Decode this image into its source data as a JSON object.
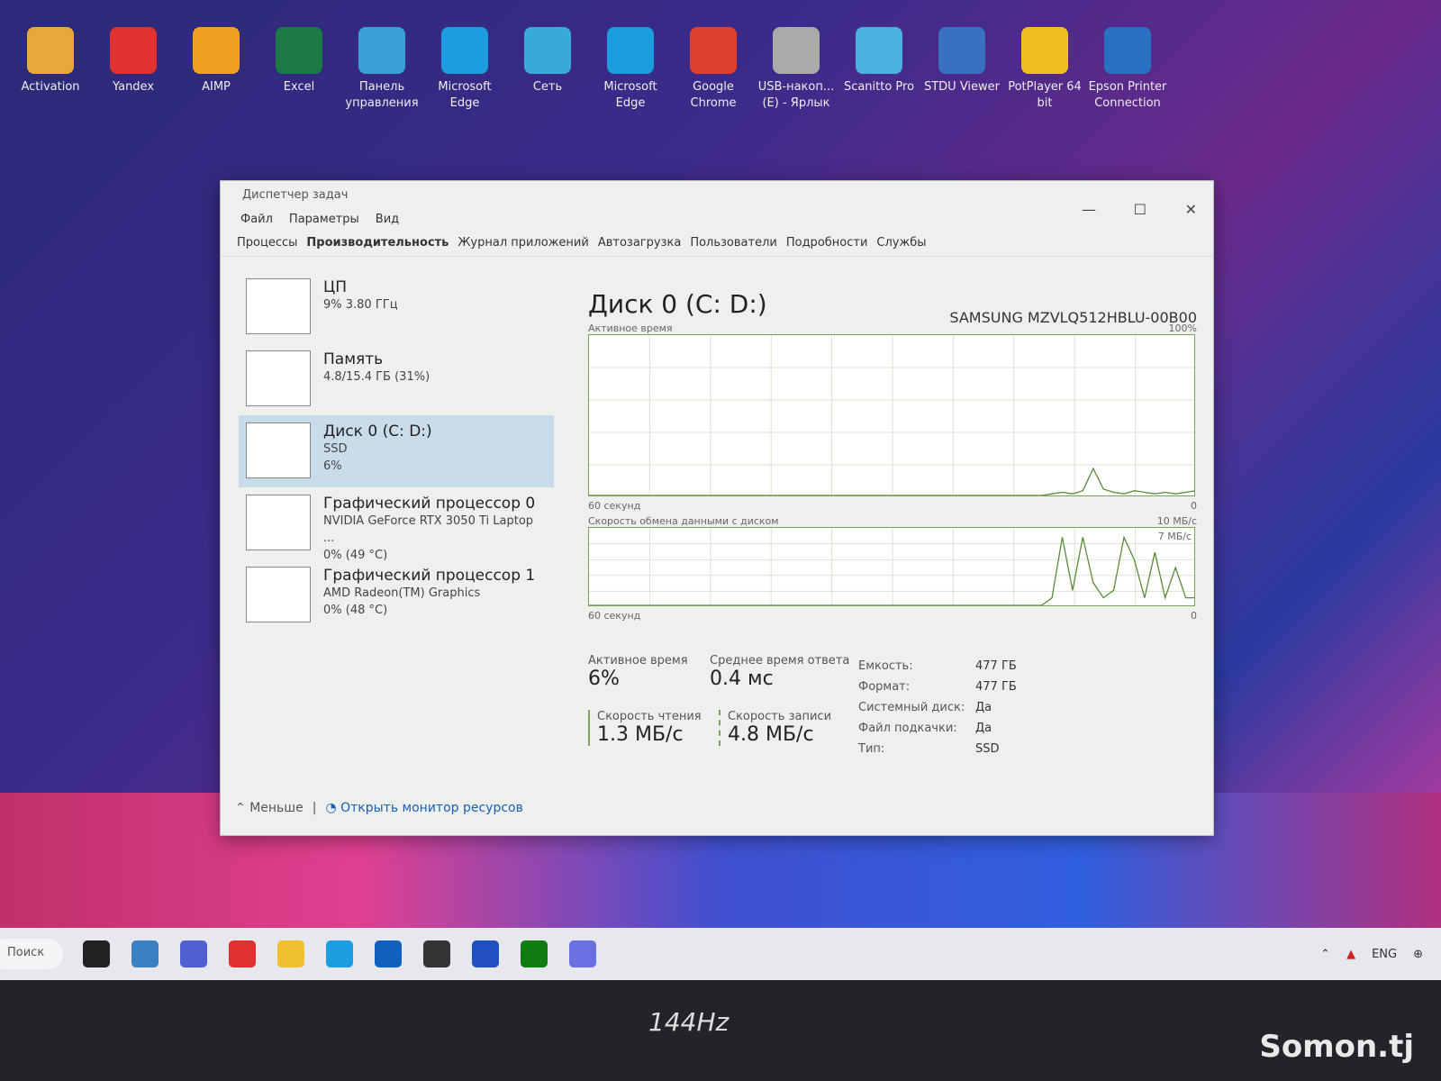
{
  "desktop": {
    "icons": [
      {
        "label": "Activation",
        "color": "#e8a83a"
      },
      {
        "label": "Yandex",
        "color": "#e03030"
      },
      {
        "label": "AIMP",
        "color": "#f0a020"
      },
      {
        "label": "Excel",
        "color": "#1e7a44"
      },
      {
        "label": "Панель управления",
        "color": "#3aa0d8"
      },
      {
        "label": "Microsoft Edge",
        "color": "#1b9de0"
      },
      {
        "label": "Сеть",
        "color": "#3aa8d8"
      },
      {
        "label": "Microsoft Edge",
        "color": "#1b9de0"
      },
      {
        "label": "Google Chrome",
        "color": "#e04030"
      },
      {
        "label": "USB-накоп... (E) - Ярлык",
        "color": "#aaa"
      },
      {
        "label": "Scanitto Pro",
        "color": "#4ab0e0"
      },
      {
        "label": "STDU Viewer",
        "color": "#3a70c0"
      },
      {
        "label": "PotPlayer 64 bit",
        "color": "#f0c020"
      },
      {
        "label": "Epson Printer Connection",
        "color": "#2a70c0"
      }
    ]
  },
  "window": {
    "title": "Диспетчер задач",
    "menu": [
      "Файл",
      "Параметры",
      "Вид"
    ],
    "tabs": [
      "Процессы",
      "Производительность",
      "Журнал приложений",
      "Автозагрузка",
      "Пользователи",
      "Подробности",
      "Службы"
    ],
    "active_tab": 1,
    "sidebar": [
      {
        "name": "ЦП",
        "l1": "9% 3.80 ГГц",
        "l2": ""
      },
      {
        "name": "Память",
        "l1": "4.8/15.4 ГБ (31%)",
        "l2": ""
      },
      {
        "name": "Диск 0 (C: D:)",
        "l1": "SSD",
        "l2": "6%"
      },
      {
        "name": "Графический процессор 0",
        "l1": "NVIDIA GeForce RTX 3050 Ti Laptop ...",
        "l2": "0% (49 °C)"
      },
      {
        "name": "Графический процессор 1",
        "l1": "AMD Radeon(TM) Graphics",
        "l2": "0% (48 °C)"
      }
    ],
    "selected": 2,
    "main": {
      "title": "Диск 0 (C: D:)",
      "model": "SAMSUNG MZVLQ512HBLU-00B00",
      "chart1": {
        "label": "Активное время",
        "max": "100%",
        "time": "60 секунд",
        "min": "0",
        "values": [
          0,
          0,
          0,
          0,
          0,
          0,
          0,
          0,
          0,
          0,
          0,
          0,
          0,
          0,
          0,
          0,
          0,
          0,
          0,
          0,
          0,
          0,
          0,
          0,
          0,
          0,
          0,
          0,
          0,
          0,
          0,
          0,
          0,
          0,
          0,
          0,
          0,
          0,
          0,
          0,
          0,
          0,
          0,
          0,
          0,
          1,
          2,
          1,
          3,
          17,
          4,
          2,
          1,
          3,
          2,
          1,
          2,
          1,
          2,
          3
        ]
      },
      "chart2": {
        "label": "Скорость обмена данными с диском",
        "max": "10 МБ/с",
        "sub": "7 МБ/с",
        "time": "60 секунд",
        "min": "0",
        "values": [
          0,
          0,
          0,
          0,
          0,
          0,
          0,
          0,
          0,
          0,
          0,
          0,
          0,
          0,
          0,
          0,
          0,
          0,
          0,
          0,
          0,
          0,
          0,
          0,
          0,
          0,
          0,
          0,
          0,
          0,
          0,
          0,
          0,
          0,
          0,
          0,
          0,
          0,
          0,
          0,
          0,
          0,
          0,
          0,
          0,
          1,
          9,
          2,
          9,
          3,
          1,
          2,
          9,
          6,
          1,
          7,
          1,
          5,
          1,
          1
        ]
      },
      "stats": {
        "active_label": "Активное время",
        "active": "6%",
        "resp_label": "Среднее время ответа",
        "resp": "0.4 мс",
        "read_label": "Скорость чтения",
        "read": "1.3 МБ/с",
        "write_label": "Скорость записи",
        "write": "4.8 МБ/с"
      },
      "props": [
        [
          "Емкость:",
          "477 ГБ"
        ],
        [
          "Формат:",
          "477 ГБ"
        ],
        [
          "Системный диск:",
          "Да"
        ],
        [
          "Файл подкачки:",
          "Да"
        ],
        [
          "Тип:",
          "SSD"
        ]
      ]
    },
    "footer": {
      "less": "Меньше",
      "monitor": "Открыть монитор ресурсов"
    }
  },
  "taskbar": {
    "search": "Поиск",
    "lang": "ENG"
  },
  "bezel": {
    "refresh": "144Hz",
    "watermark": "Somon.tj"
  }
}
